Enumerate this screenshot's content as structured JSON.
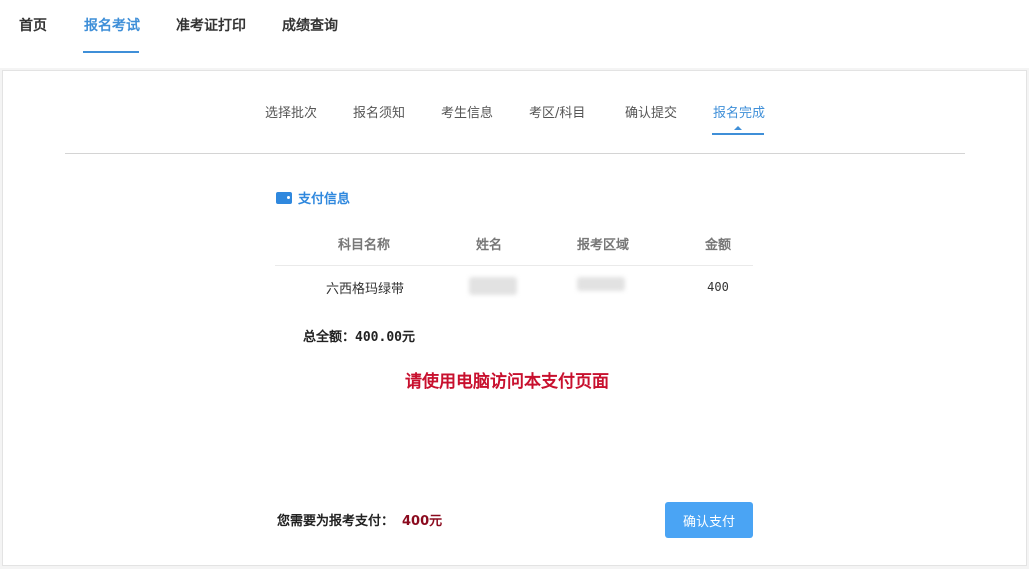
{
  "topnav": {
    "items": [
      "首页",
      "报名考试",
      "准考证打印",
      "成绩查询"
    ],
    "active_index": 1
  },
  "steps": {
    "items": [
      "选择批次",
      "报名须知",
      "考生信息",
      "考区/科目",
      "确认提交",
      "报名完成"
    ],
    "active_index": 5
  },
  "payment": {
    "section_title": "支付信息",
    "icon": "wallet-icon",
    "table": {
      "headers": [
        "科目名称",
        "姓名",
        "报考区域",
        "金额"
      ],
      "rows": [
        {
          "subject": "六西格玛绿带",
          "name": "",
          "region": "",
          "amount": "400"
        }
      ]
    },
    "total_label": "总全额：",
    "total_value": "400.00元",
    "warning": "请使用电脑访问本支付页面",
    "pay_label": "您需要为报考支付：",
    "pay_value": "400元",
    "confirm_label": "确认支付"
  },
  "colors": {
    "accent": "#3f8fd8",
    "button": "#4aa4f4",
    "warning": "#c8102e",
    "amount": "#8b0a1e"
  }
}
